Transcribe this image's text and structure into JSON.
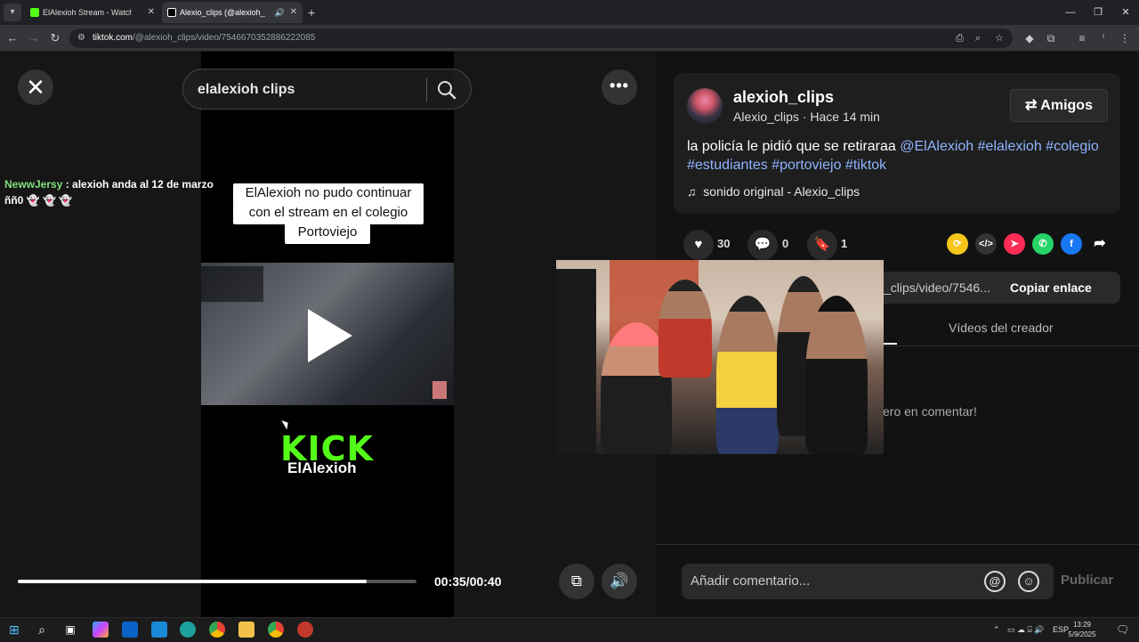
{
  "browser": {
    "tabs": [
      {
        "title": "ElAlexioh Stream - Watch Live o",
        "favicon_color": "#53fc18"
      },
      {
        "title": "Alexio_clips (@alexioh_clip",
        "favicon_color": "#ffffff"
      }
    ],
    "url_host": "tiktok.com",
    "url_path": "/@alexioh_clips/video/7546670352886222085"
  },
  "player": {
    "search_query": "elalexioh clips",
    "chat": {
      "user": "NewwJersy",
      "message": " : alexioh anda al 12 de marzo ññ0 👻 👻 👻"
    },
    "caption_lines": [
      "ElAlexioh no pudo continuar",
      "con el stream en el colegio",
      "Portoviejo"
    ],
    "kick_logo": "KICK",
    "kick_channel": "ElAlexioh",
    "time": "00:35/00:40",
    "progress": 0.875
  },
  "post": {
    "username": "alexioh_clips",
    "display_line": "Alexio_clips · Hace 14 min",
    "friends_label": "Amigos",
    "description_text": "la policía le pidió que se retiraraa ",
    "mention": "@ElAlexioh",
    "hashtags": [
      "#elalexioh",
      "#colegio",
      "#estudiantes",
      "#portoviejo",
      "#tiktok"
    ],
    "sound": "sonido original - Alexio_clips",
    "likes": "30",
    "comments": "0",
    "saves": "1",
    "link_fragment": "_clips/video/7546...",
    "copy_label": "Copiar enlace",
    "creator_tab": "Vídeos del creador",
    "empty_comments": "ero en comentar!",
    "comment_placeholder": "Añadir comentario...",
    "publish_label": "Publicar"
  },
  "taskbar": {
    "lang": "ESP",
    "time": "13:29",
    "date": "5/9/2025"
  }
}
